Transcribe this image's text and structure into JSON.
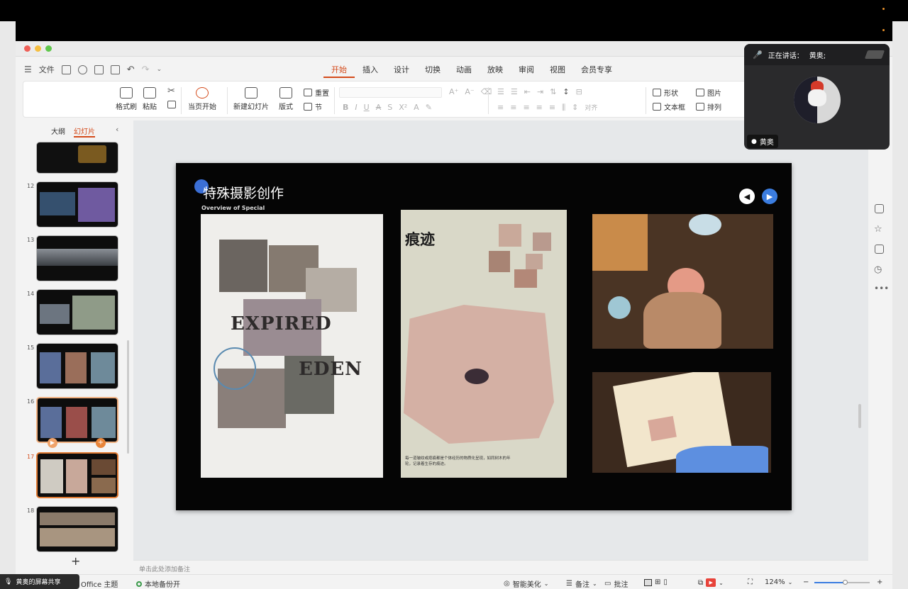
{
  "menubar": {
    "file_label": "文件"
  },
  "tabs": [
    "开始",
    "插入",
    "设计",
    "切换",
    "动画",
    "放映",
    "审阅",
    "视图",
    "会员专享"
  ],
  "ribbon": {
    "format_brush": "格式刷",
    "paste": "粘贴",
    "start_current": "当页开始",
    "new_slide": "新建幻灯片",
    "layout": "版式",
    "reset": "重置",
    "section": "节",
    "align": "对齐",
    "shape": "形状",
    "picture": "图片",
    "textbox": "文本框",
    "arrange": "排列"
  },
  "left_panel": {
    "outline_tab": "大纲",
    "slides_tab": "幻灯片",
    "slide_numbers": [
      "12",
      "13",
      "14",
      "15",
      "16",
      "17",
      "18"
    ],
    "add_label": "+"
  },
  "slide": {
    "title": "特殊摄影创作",
    "subtitle": "Overview of Special",
    "panel1": {
      "word1": "EXPIRED",
      "word2": "EDEN"
    },
    "panel2": {
      "heading": "痕迹",
      "caption": "每一道皱纹或疤痕都是个体经历的物质化呈现，如同树木的年轮，记录着生存的痕迹。"
    }
  },
  "notes": {
    "placeholder": "单击此处添加备注"
  },
  "statusbar": {
    "theme": "Office 主题",
    "backup": "本地备份开",
    "beautify": "智能美化",
    "notes_btn": "备注",
    "comments_btn": "批注",
    "zoom": "124%"
  },
  "share_pill": {
    "label": "黄奥的屏幕共享"
  },
  "call": {
    "speaking_label": "正在讲话：",
    "speaker_name": "黄奥;",
    "participant_name": "黄奥"
  }
}
